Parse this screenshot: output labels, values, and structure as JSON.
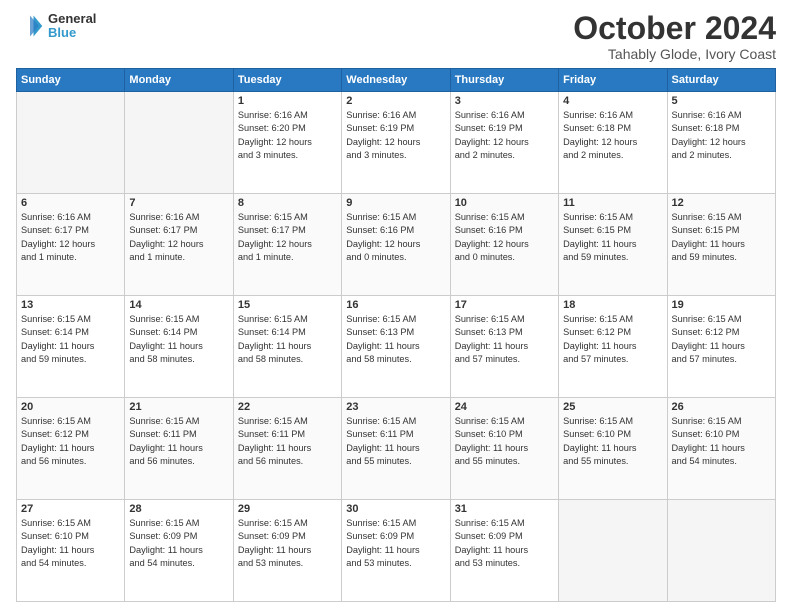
{
  "header": {
    "logo_line1": "General",
    "logo_line2": "Blue",
    "month": "October 2024",
    "location": "Tahably Glode, Ivory Coast"
  },
  "weekdays": [
    "Sunday",
    "Monday",
    "Tuesday",
    "Wednesday",
    "Thursday",
    "Friday",
    "Saturday"
  ],
  "weeks": [
    [
      {
        "day": "",
        "info": ""
      },
      {
        "day": "",
        "info": ""
      },
      {
        "day": "1",
        "info": "Sunrise: 6:16 AM\nSunset: 6:20 PM\nDaylight: 12 hours\nand 3 minutes."
      },
      {
        "day": "2",
        "info": "Sunrise: 6:16 AM\nSunset: 6:19 PM\nDaylight: 12 hours\nand 3 minutes."
      },
      {
        "day": "3",
        "info": "Sunrise: 6:16 AM\nSunset: 6:19 PM\nDaylight: 12 hours\nand 2 minutes."
      },
      {
        "day": "4",
        "info": "Sunrise: 6:16 AM\nSunset: 6:18 PM\nDaylight: 12 hours\nand 2 minutes."
      },
      {
        "day": "5",
        "info": "Sunrise: 6:16 AM\nSunset: 6:18 PM\nDaylight: 12 hours\nand 2 minutes."
      }
    ],
    [
      {
        "day": "6",
        "info": "Sunrise: 6:16 AM\nSunset: 6:17 PM\nDaylight: 12 hours\nand 1 minute."
      },
      {
        "day": "7",
        "info": "Sunrise: 6:16 AM\nSunset: 6:17 PM\nDaylight: 12 hours\nand 1 minute."
      },
      {
        "day": "8",
        "info": "Sunrise: 6:15 AM\nSunset: 6:17 PM\nDaylight: 12 hours\nand 1 minute."
      },
      {
        "day": "9",
        "info": "Sunrise: 6:15 AM\nSunset: 6:16 PM\nDaylight: 12 hours\nand 0 minutes."
      },
      {
        "day": "10",
        "info": "Sunrise: 6:15 AM\nSunset: 6:16 PM\nDaylight: 12 hours\nand 0 minutes."
      },
      {
        "day": "11",
        "info": "Sunrise: 6:15 AM\nSunset: 6:15 PM\nDaylight: 11 hours\nand 59 minutes."
      },
      {
        "day": "12",
        "info": "Sunrise: 6:15 AM\nSunset: 6:15 PM\nDaylight: 11 hours\nand 59 minutes."
      }
    ],
    [
      {
        "day": "13",
        "info": "Sunrise: 6:15 AM\nSunset: 6:14 PM\nDaylight: 11 hours\nand 59 minutes."
      },
      {
        "day": "14",
        "info": "Sunrise: 6:15 AM\nSunset: 6:14 PM\nDaylight: 11 hours\nand 58 minutes."
      },
      {
        "day": "15",
        "info": "Sunrise: 6:15 AM\nSunset: 6:14 PM\nDaylight: 11 hours\nand 58 minutes."
      },
      {
        "day": "16",
        "info": "Sunrise: 6:15 AM\nSunset: 6:13 PM\nDaylight: 11 hours\nand 58 minutes."
      },
      {
        "day": "17",
        "info": "Sunrise: 6:15 AM\nSunset: 6:13 PM\nDaylight: 11 hours\nand 57 minutes."
      },
      {
        "day": "18",
        "info": "Sunrise: 6:15 AM\nSunset: 6:12 PM\nDaylight: 11 hours\nand 57 minutes."
      },
      {
        "day": "19",
        "info": "Sunrise: 6:15 AM\nSunset: 6:12 PM\nDaylight: 11 hours\nand 57 minutes."
      }
    ],
    [
      {
        "day": "20",
        "info": "Sunrise: 6:15 AM\nSunset: 6:12 PM\nDaylight: 11 hours\nand 56 minutes."
      },
      {
        "day": "21",
        "info": "Sunrise: 6:15 AM\nSunset: 6:11 PM\nDaylight: 11 hours\nand 56 minutes."
      },
      {
        "day": "22",
        "info": "Sunrise: 6:15 AM\nSunset: 6:11 PM\nDaylight: 11 hours\nand 56 minutes."
      },
      {
        "day": "23",
        "info": "Sunrise: 6:15 AM\nSunset: 6:11 PM\nDaylight: 11 hours\nand 55 minutes."
      },
      {
        "day": "24",
        "info": "Sunrise: 6:15 AM\nSunset: 6:10 PM\nDaylight: 11 hours\nand 55 minutes."
      },
      {
        "day": "25",
        "info": "Sunrise: 6:15 AM\nSunset: 6:10 PM\nDaylight: 11 hours\nand 55 minutes."
      },
      {
        "day": "26",
        "info": "Sunrise: 6:15 AM\nSunset: 6:10 PM\nDaylight: 11 hours\nand 54 minutes."
      }
    ],
    [
      {
        "day": "27",
        "info": "Sunrise: 6:15 AM\nSunset: 6:10 PM\nDaylight: 11 hours\nand 54 minutes."
      },
      {
        "day": "28",
        "info": "Sunrise: 6:15 AM\nSunset: 6:09 PM\nDaylight: 11 hours\nand 54 minutes."
      },
      {
        "day": "29",
        "info": "Sunrise: 6:15 AM\nSunset: 6:09 PM\nDaylight: 11 hours\nand 53 minutes."
      },
      {
        "day": "30",
        "info": "Sunrise: 6:15 AM\nSunset: 6:09 PM\nDaylight: 11 hours\nand 53 minutes."
      },
      {
        "day": "31",
        "info": "Sunrise: 6:15 AM\nSunset: 6:09 PM\nDaylight: 11 hours\nand 53 minutes."
      },
      {
        "day": "",
        "info": ""
      },
      {
        "day": "",
        "info": ""
      }
    ]
  ]
}
